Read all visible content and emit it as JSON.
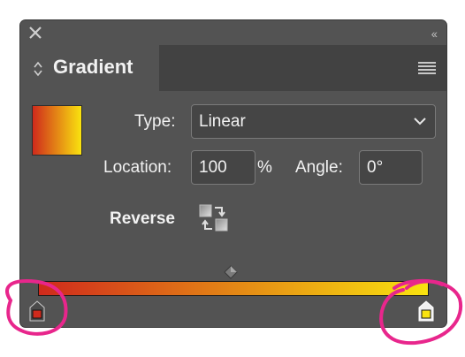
{
  "panel": {
    "title": "Gradient",
    "close_icon": "close-icon",
    "collapse_icon": "double-chevron-left-icon",
    "menu_icon": "panel-menu-icon",
    "tab_icon": "up-down-arrows-icon"
  },
  "fields": {
    "type_label": "Type:",
    "type_value": "Linear",
    "location_label": "Location:",
    "location_value": "100",
    "location_unit": "%",
    "angle_label": "Angle:",
    "angle_value": "0°",
    "reverse_label": "Reverse"
  },
  "gradient": {
    "start_color": "#cf2a1c",
    "end_color": "#f9e30f",
    "stops": [
      {
        "position_percent": 0,
        "color": "#cf2a1c"
      },
      {
        "position_percent": 100,
        "color": "#f9e30f"
      }
    ],
    "midpoint_percent": 50
  },
  "annotations": {
    "color": "#e8268c"
  }
}
